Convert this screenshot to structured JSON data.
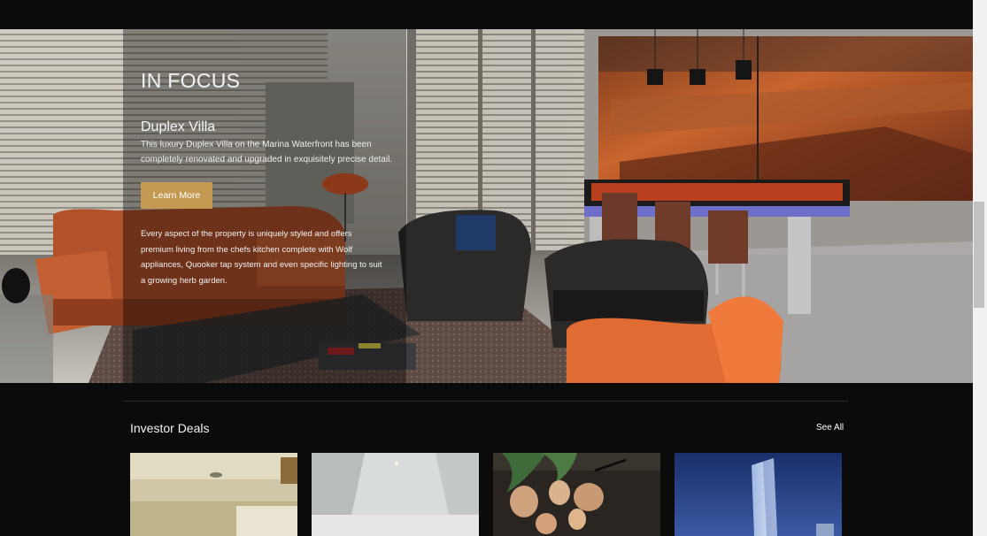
{
  "hero": {
    "section_heading": "IN FOCUS",
    "property_title": "Duplex Villa",
    "property_description": "This luxury Duplex Villa on the Marina Waterfront has been completely renovated and upgraded in exquisitely precise detail.",
    "cta_label": "Learn More",
    "property_detail": "Every aspect of the property is uniquely styled and offers premium living from the chefs kitchen complete with Wolf appliances, Quooker tap system and even specific lighting to suit a growing herb garden."
  },
  "deals": {
    "title": "Investor Deals",
    "see_all_label": "See All"
  },
  "colors": {
    "page_background": "#0b0b0b",
    "button_gold": "#c49a52",
    "text_primary": "#ffffff"
  }
}
